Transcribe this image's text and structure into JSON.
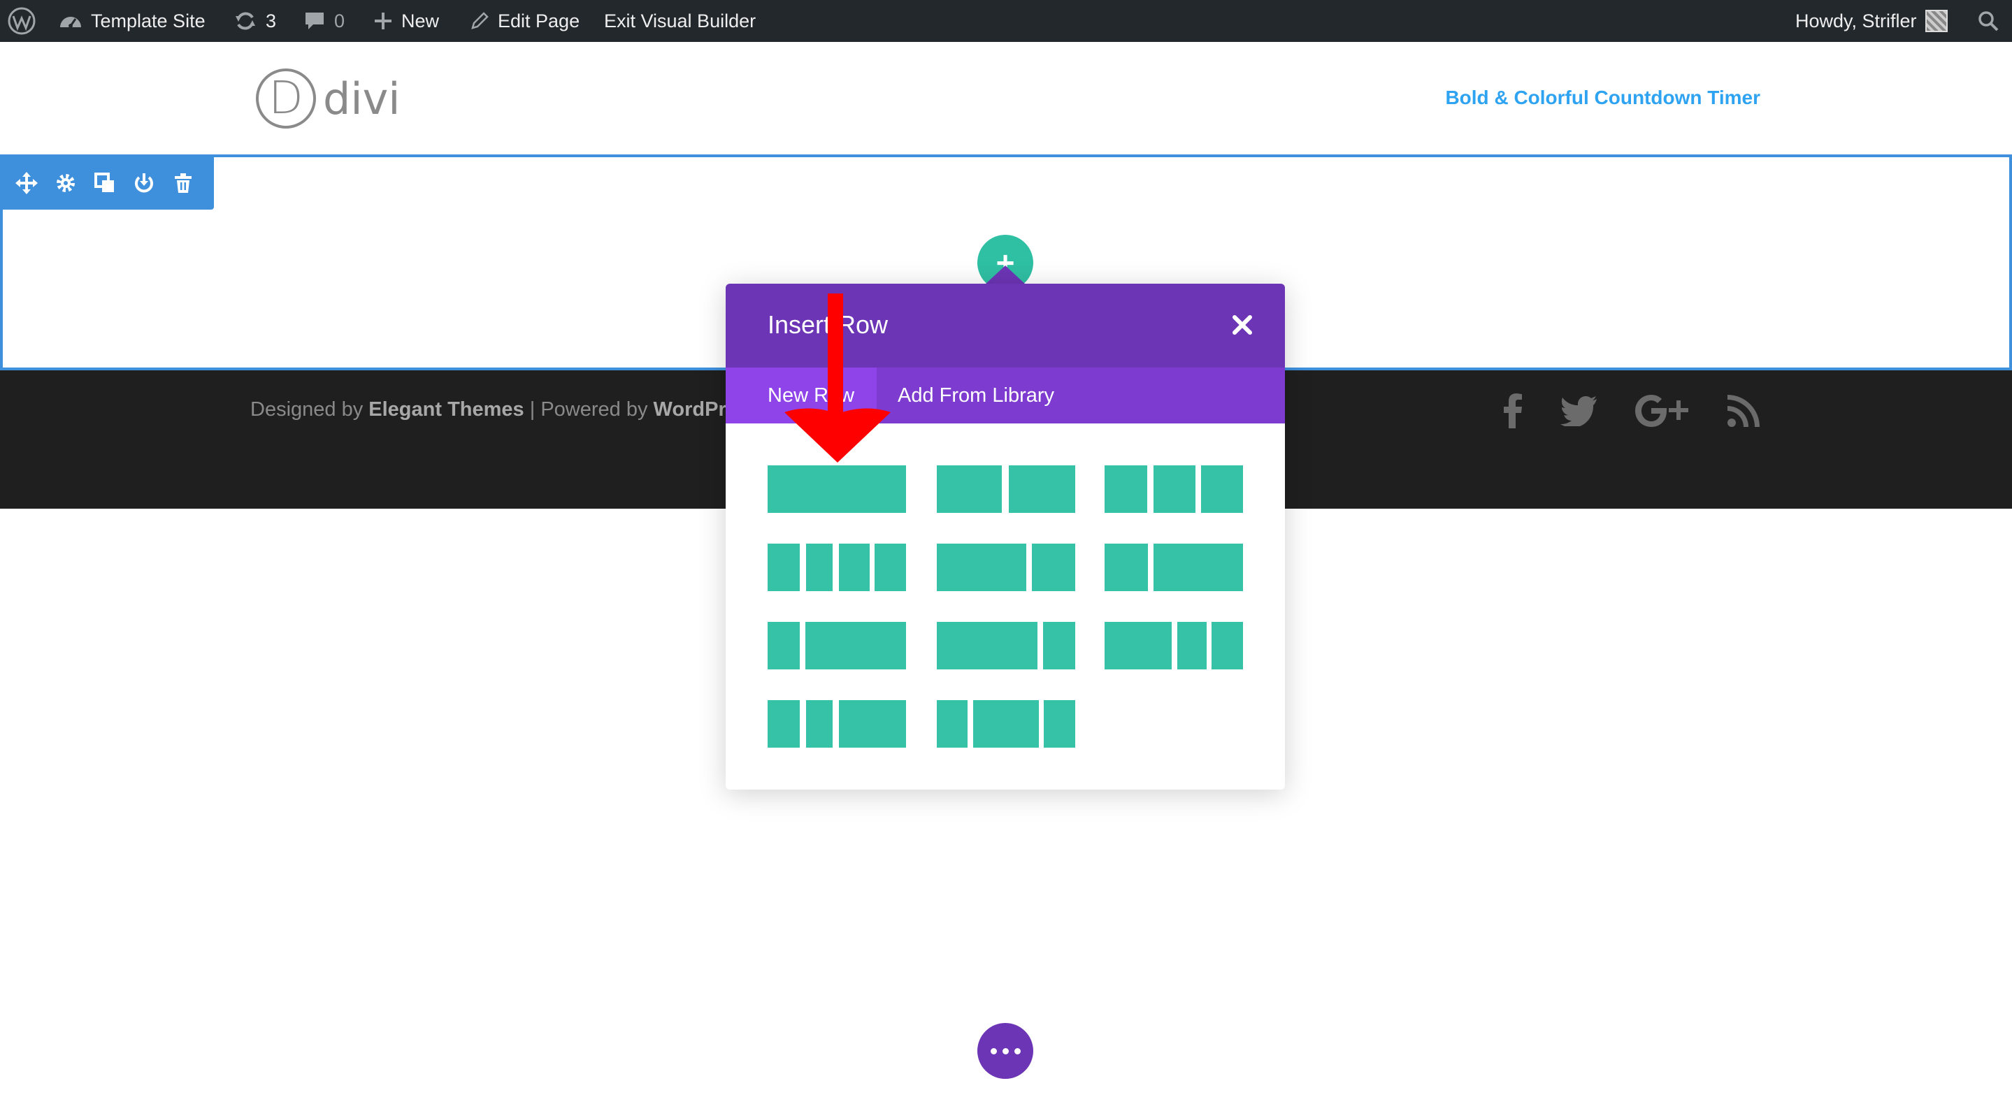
{
  "admin_bar": {
    "site_name": "Template Site",
    "updates_count": "3",
    "comments_count": "0",
    "new_label": "New",
    "edit_page_label": "Edit Page",
    "exit_builder_label": "Exit Visual Builder",
    "greeting": "Howdy, Strifler"
  },
  "header": {
    "logo_letter": "D",
    "logo_text": "divi",
    "nav_link": "Bold & Colorful Countdown Timer"
  },
  "footer": {
    "designed_by": "Designed by ",
    "theme_author": "Elegant Themes",
    "separator": " | Powered by ",
    "platform": "WordPr",
    "social": [
      "facebook-icon",
      "twitter-icon",
      "google-plus-icon",
      "rss-icon"
    ]
  },
  "modal": {
    "title": "Insert Row",
    "tabs": [
      "New Row",
      "Add From Library"
    ],
    "layouts": [
      "1",
      "1/2 + 1/2",
      "1/3 + 1/3 + 1/3",
      "1/4 + 1/4 + 1/4 + 1/4",
      "2/3 + 1/3",
      "1/3 + 2/3",
      "1/4 + 3/4",
      "3/4 + 1/4",
      "1/2 + 1/4 + 1/4",
      "1/4 + 1/4 + 1/2",
      "1/4 + 1/2 + 1/4"
    ]
  },
  "colors": {
    "admin_bar": "#23282d",
    "section_outline": "#3e8fdc",
    "modal_header": "#6c35b5",
    "modal_tabs": "#7e3bd0",
    "active_tab": "#8e44e8",
    "layout_block": "#35c2a6",
    "add_button": "#2fbfa3",
    "footer": "#1f1f1f",
    "annotation_arrow": "#ff0000"
  }
}
